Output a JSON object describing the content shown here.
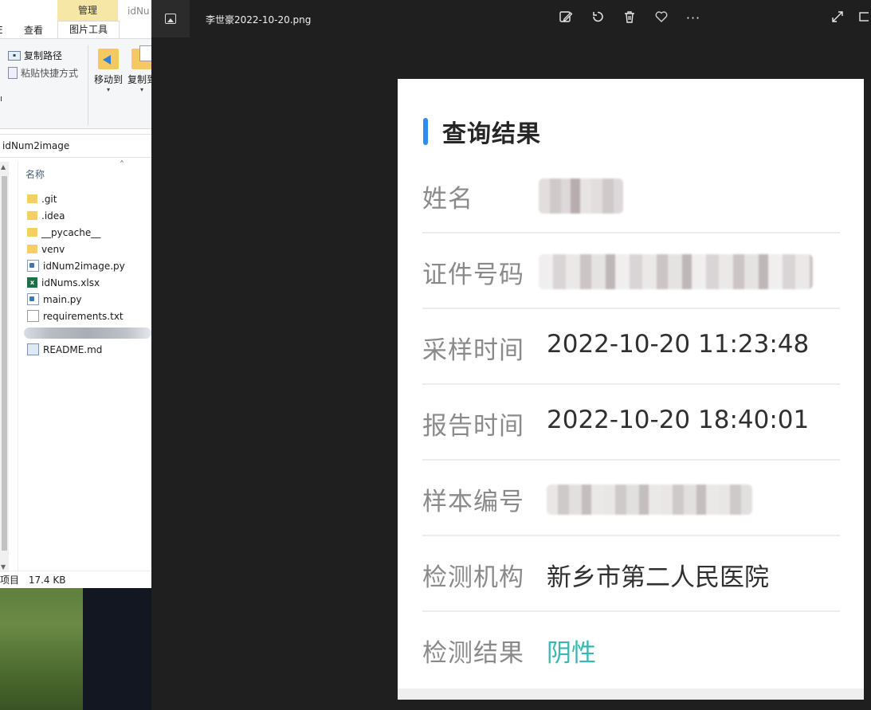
{
  "explorer": {
    "ribbon": {
      "contextual_group": "管理",
      "tab_edge": "E",
      "tab_view": "查看",
      "tab_picture_tools": "图片工具",
      "tab_overflow": "idNu",
      "copy_path": "复制路径",
      "paste_shortcut": "粘贴快捷方式",
      "move_to": "移动到",
      "copy_to": "复制到"
    },
    "address": "idNum2image",
    "column_name": "名称",
    "files": [
      {
        "name": ".git",
        "type": "folder"
      },
      {
        "name": ".idea",
        "type": "folder"
      },
      {
        "name": "__pycache__",
        "type": "folder"
      },
      {
        "name": "venv",
        "type": "folder"
      },
      {
        "name": "idNum2image.py",
        "type": "python"
      },
      {
        "name": "idNums.xlsx",
        "type": "excel"
      },
      {
        "name": "main.py",
        "type": "python"
      },
      {
        "name": "requirements.txt",
        "type": "text"
      },
      {
        "name": "",
        "type": "redacted"
      },
      {
        "name": "README.md",
        "type": "markdown"
      }
    ],
    "status": {
      "items_fragment": "项目",
      "size": "17.4 KB"
    }
  },
  "viewer": {
    "file_title": "李世豪2022-10-20.png",
    "toolbar_icons": [
      "edit-icon",
      "rotate-icon",
      "delete-icon",
      "favorite-icon",
      "more-icon"
    ],
    "window_icons": [
      "expand-icon",
      "fullscreen-icon"
    ],
    "more_glyph": "···",
    "card": {
      "title": "查询结果",
      "rows": [
        {
          "label": "姓名",
          "value": "",
          "redacted": true
        },
        {
          "label": "证件号码",
          "value": "",
          "redacted": true
        },
        {
          "label": "采样时间",
          "value": "2022-10-20 11:23:48"
        },
        {
          "label": "报告时间",
          "value": "2022-10-20 18:40:01"
        },
        {
          "label": "样本编号",
          "value": "",
          "redacted": true
        },
        {
          "label": "检测机构",
          "value": "新乡市第二人民医院"
        },
        {
          "label": "检测结果",
          "value": "阴性"
        }
      ]
    },
    "colors": {
      "accent": "#2d8cf0",
      "negative_result": "#38b9b0",
      "viewer_bg": "#1f1f1f"
    }
  }
}
